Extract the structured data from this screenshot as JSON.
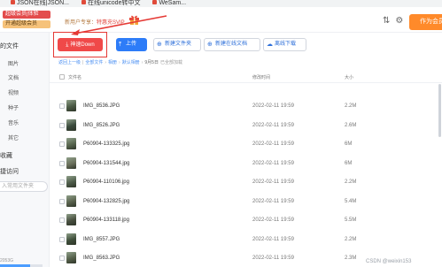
{
  "bookmarks": [
    "JSON在线|JSON...",
    "在线unicode转中文",
    "WeSam..."
  ],
  "header": {
    "vip_badge": "超级会员|体验",
    "vip_join": "开通超级会员",
    "promo_prefix": "新用户专享：",
    "promo_highlight": "特惠充SVIP",
    "member_button": "作为会员",
    "colors": {
      "vip": "#e34c4c",
      "member": "#ff8a2a"
    }
  },
  "sidebar": {
    "title": "的文件",
    "items": [
      "图片",
      "文档",
      "视频",
      "种子",
      "音乐",
      "其它"
    ],
    "section_favorites": "收藏",
    "section_quick": "捷访问",
    "search_placeholder": "入常用文件夹",
    "storage_text": "2053G"
  },
  "toolbar": {
    "speed_download": "神速Down",
    "upload": "上传",
    "new_folder": "新建文件夹",
    "new_doc": "新建在线文档",
    "offline_download": "离线下载",
    "colors": {
      "speed": "#f04949",
      "upload": "#2d7cf8",
      "annotation": "#e53935"
    }
  },
  "breadcrumb": {
    "items": [
      "返回上一级",
      "全部文件",
      "相册",
      "默认相册",
      "9月5日"
    ],
    "loaded": "已全部加载"
  },
  "table": {
    "columns": {
      "name": "文件名",
      "modified": "修改时间",
      "size": "大小"
    },
    "rows": [
      {
        "name": "IMG_8536.JPG",
        "modified": "2022-02-11 19:59",
        "size": "2.2M",
        "thumb": "#4b5a45"
      },
      {
        "name": "IMG_8526.JPG",
        "modified": "2022-02-11 19:59",
        "size": "2.6M",
        "thumb": "#3a4a3c"
      },
      {
        "name": "P60904-133325.jpg",
        "modified": "2022-02-11 19:59",
        "size": "6M",
        "thumb": "#58664f"
      },
      {
        "name": "P60904-131544.jpg",
        "modified": "2022-02-11 19:59",
        "size": "6M",
        "thumb": "#6a6f5b"
      },
      {
        "name": "P60904-110106.jpg",
        "modified": "2022-02-11 19:59",
        "size": "2.2M",
        "thumb": "#4d5b49"
      },
      {
        "name": "P60904-132825.jpg",
        "modified": "2022-02-11 19:59",
        "size": "5.4M",
        "thumb": "#59624d"
      },
      {
        "name": "P60904-133118.jpg",
        "modified": "2022-02-11 19:59",
        "size": "5.5M",
        "thumb": "#484f3f"
      },
      {
        "name": "IMG_8557.JPG",
        "modified": "2022-02-11 19:59",
        "size": "2.2M",
        "thumb": "#3e4e3a"
      },
      {
        "name": "IMG_8563.JPG",
        "modified": "2022-02-11 19:59",
        "size": "2.3M",
        "thumb": "#55604a"
      }
    ]
  },
  "watermark": "CSDN @weixin153"
}
